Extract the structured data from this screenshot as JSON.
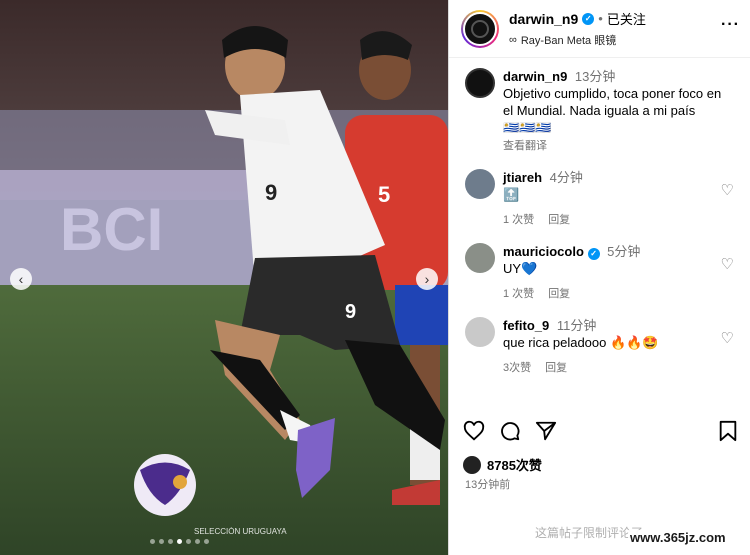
{
  "post": {
    "author": "darwin_n9",
    "follow_status": "已关注",
    "audio": "Ray-Ban Meta 眼镜",
    "caption_time": "13分钟",
    "caption": "Objetivo cumplido, toca poner foco en el Mundial. Nada iguala a mi país",
    "caption_emoji": "🇺🇾🇺🇾🇺🇾",
    "translate": "查看翻译",
    "likes": "8785次赞",
    "posted_ago": "13分钟前",
    "comments_limited": "这篇帖子限制评论了"
  },
  "comments": [
    {
      "user": "jtiareh",
      "time": "4分钟",
      "text": "🔝",
      "likes": "1 次赞",
      "reply": "回复"
    },
    {
      "user": "mauriciocolo",
      "verified": true,
      "time": "5分钟",
      "text": "UY💙",
      "likes": "1 次赞",
      "reply": "回复"
    },
    {
      "user": "fefito_9",
      "time": "11分钟",
      "text": "que rica peladooo 🔥🔥🤩",
      "likes": "3次赞",
      "reply": "回复"
    }
  ],
  "photo": {
    "watermark": "SELECCIÓN URUGUAYA",
    "jersey_white_number": "9",
    "jersey_red_number": "5",
    "slide_index": 3,
    "slide_count": 7
  },
  "site_watermark": "www.365jz.com",
  "icons": {
    "more": "more-dots-icon",
    "like": "heart-icon",
    "comment": "comment-icon",
    "share": "share-icon",
    "save": "bookmark-icon"
  }
}
